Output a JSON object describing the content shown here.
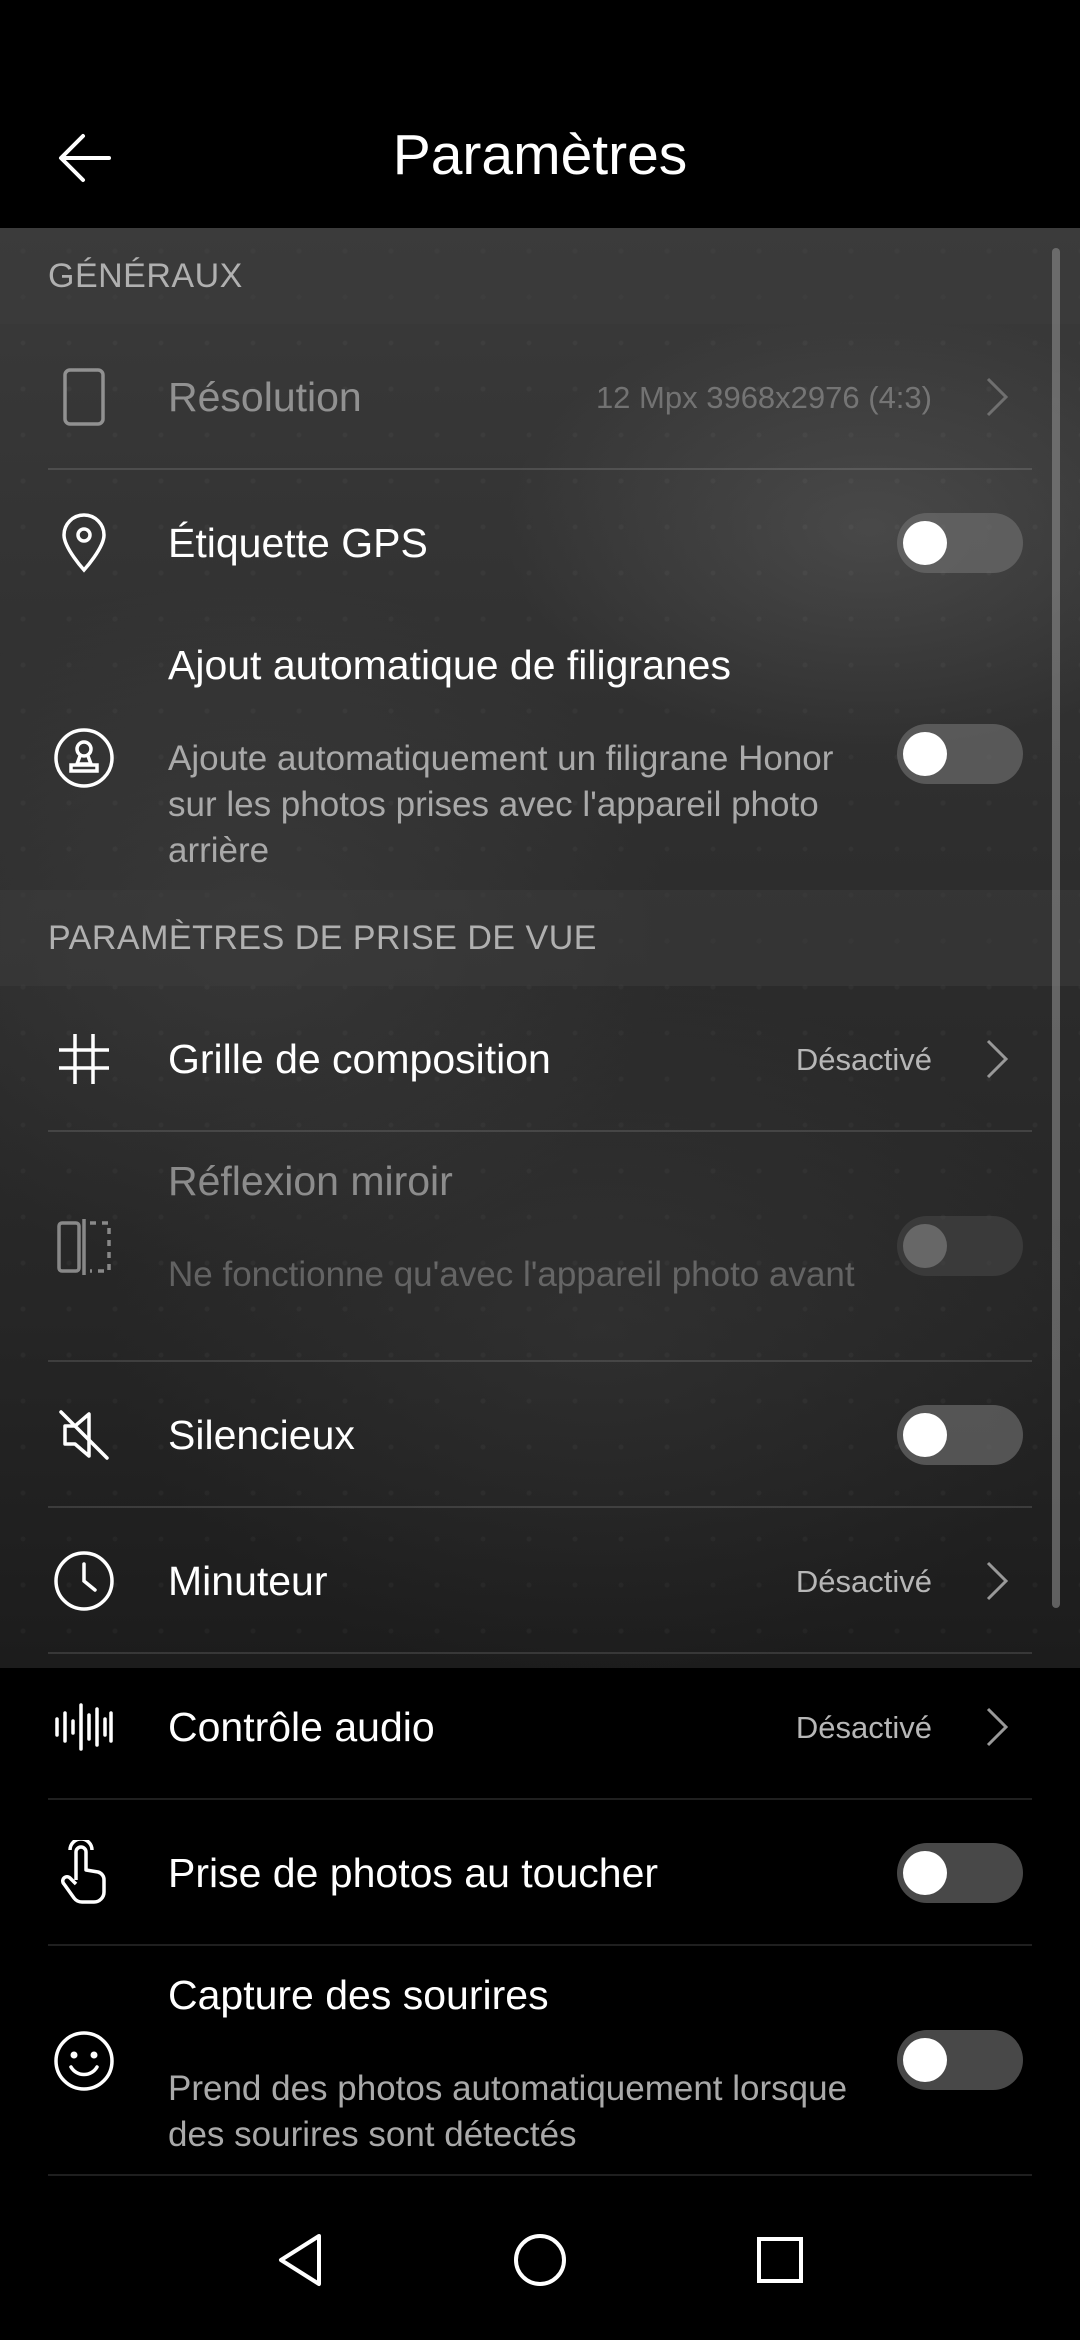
{
  "header": {
    "title": "Paramètres",
    "back_icon": "arrow-left-icon"
  },
  "sections": {
    "general": "GÉNÉRAUX",
    "shooting": "PARAMÈTRES DE PRISE DE VUE"
  },
  "settings": {
    "resolution": {
      "label": "Résolution",
      "value": "12 Mpx 3968x2976 (4:3)",
      "icon": "phone-icon",
      "enabled": false
    },
    "gps": {
      "label": "Étiquette GPS",
      "icon": "location-pin-icon",
      "toggle": false
    },
    "watermark": {
      "label": "Ajout automatique de filigranes",
      "sub": "Ajoute automatiquement un filigrane Honor sur les photos prises avec l'appareil photo arrière",
      "icon": "stamp-icon",
      "toggle": false
    },
    "grid": {
      "label": "Grille de composition",
      "value": "Désactivé",
      "icon": "grid-icon"
    },
    "mirror": {
      "label": "Réflexion miroir",
      "sub": "Ne fonctionne qu'avec l'appareil photo avant",
      "icon": "mirror-icon",
      "toggle": false,
      "enabled": false
    },
    "silent": {
      "label": "Silencieux",
      "icon": "speaker-mute-icon",
      "toggle": false
    },
    "timer": {
      "label": "Minuteur",
      "value": "Désactivé",
      "icon": "clock-icon"
    },
    "audio": {
      "label": "Contrôle audio",
      "value": "Désactivé",
      "icon": "audio-wave-icon"
    },
    "touch": {
      "label": "Prise de photos au toucher",
      "icon": "touch-hand-icon",
      "toggle": false
    },
    "smile": {
      "label": "Capture des sourires",
      "sub": "Prend des photos automatiquement lorsque des sourires sont détectés",
      "icon": "smiley-icon",
      "toggle": false
    }
  },
  "navbar": {
    "back": "triangle-back-icon",
    "home": "circle-home-icon",
    "recents": "square-recents-icon"
  }
}
